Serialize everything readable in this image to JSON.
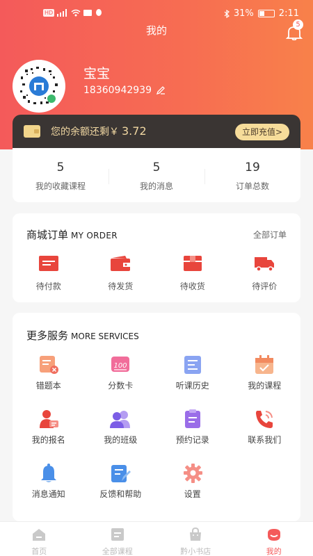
{
  "status": {
    "battery": "31%",
    "time": "2:11",
    "left_badge": "HD"
  },
  "header": {
    "title": "我的",
    "notification_count": "5"
  },
  "profile": {
    "name": "宝宝",
    "phone": "18360942939"
  },
  "balance": {
    "label": "您的余额还剩￥",
    "amount": "3.72",
    "button": "立即充值>"
  },
  "stats": [
    {
      "num": "5",
      "label": "我的收藏课程"
    },
    {
      "num": "5",
      "label": "我的消息"
    },
    {
      "num": "19",
      "label": "订单总数"
    }
  ],
  "orders": {
    "title": "商城订单",
    "title_en": "MY ORDER",
    "link": "全部订单",
    "items": [
      {
        "label": "待付款",
        "icon": "wallet-card-icon"
      },
      {
        "label": "待发货",
        "icon": "wallet-icon"
      },
      {
        "label": "待收货",
        "icon": "package-icon"
      },
      {
        "label": "待评价",
        "icon": "truck-icon"
      }
    ]
  },
  "services": {
    "title": "更多服务",
    "title_en": "MORE SERVICES",
    "items": [
      {
        "label": "错题本",
        "icon": "wrong-book-icon"
      },
      {
        "label": "分数卡",
        "icon": "score-card-icon"
      },
      {
        "label": "听课历史",
        "icon": "history-icon"
      },
      {
        "label": "我的课程",
        "icon": "calendar-check-icon"
      },
      {
        "label": "我的报名",
        "icon": "registration-icon"
      },
      {
        "label": "我的班级",
        "icon": "class-icon"
      },
      {
        "label": "预约记录",
        "icon": "appointment-icon"
      },
      {
        "label": "联系我们",
        "icon": "phone-icon"
      },
      {
        "label": "消息通知",
        "icon": "bell-icon"
      },
      {
        "label": "反馈和帮助",
        "icon": "feedback-icon"
      },
      {
        "label": "设置",
        "icon": "gear-icon"
      }
    ]
  },
  "tabs": [
    {
      "label": "首页",
      "icon": "home-icon"
    },
    {
      "label": "全部课程",
      "icon": "courses-icon"
    },
    {
      "label": "黔小书店",
      "icon": "shop-bag-icon"
    },
    {
      "label": "我的",
      "icon": "profile-icon"
    }
  ],
  "colors": {
    "accent": "#f45a5a",
    "gold": "#f6dc9a",
    "dark": "#3a3533"
  }
}
